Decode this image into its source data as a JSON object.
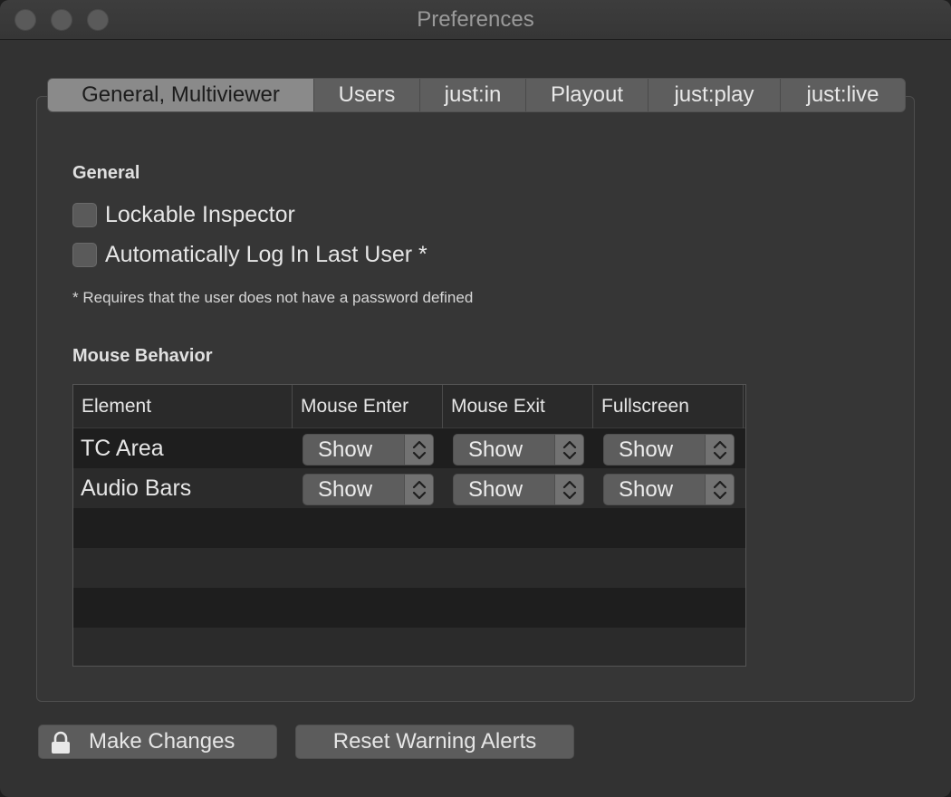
{
  "window": {
    "title": "Preferences"
  },
  "tabs": [
    {
      "label": "General, Multiviewer",
      "active": true
    },
    {
      "label": "Users",
      "active": false
    },
    {
      "label": "just:in",
      "active": false
    },
    {
      "label": "Playout",
      "active": false
    },
    {
      "label": "just:play",
      "active": false
    },
    {
      "label": "just:live",
      "active": false
    }
  ],
  "general": {
    "title": "General",
    "lockable_inspector": {
      "label": "Lockable Inspector",
      "checked": false
    },
    "auto_login": {
      "label": "Automatically Log In Last User *",
      "checked": false
    },
    "note": "* Requires that the user does not have a password defined"
  },
  "mouse_behavior": {
    "title": "Mouse Behavior",
    "columns": [
      "Element",
      "Mouse Enter",
      "Mouse Exit",
      "Fullscreen"
    ],
    "rows": [
      {
        "element": "TC Area",
        "mouse_enter": "Show",
        "mouse_exit": "Show",
        "fullscreen": "Show"
      },
      {
        "element": "Audio Bars",
        "mouse_enter": "Show",
        "mouse_exit": "Show",
        "fullscreen": "Show"
      }
    ]
  },
  "buttons": {
    "make_changes": "Make Changes",
    "reset_alerts": "Reset Warning Alerts"
  },
  "icons": {
    "lock": "lock-icon",
    "popup_arrows": "up-down-chevron-icon"
  },
  "colors": {
    "window_bg": "#323232",
    "tab_active": "#8a8a8a",
    "tab_inactive": "#5e5e5e",
    "button_bg": "#5c5c5c"
  }
}
